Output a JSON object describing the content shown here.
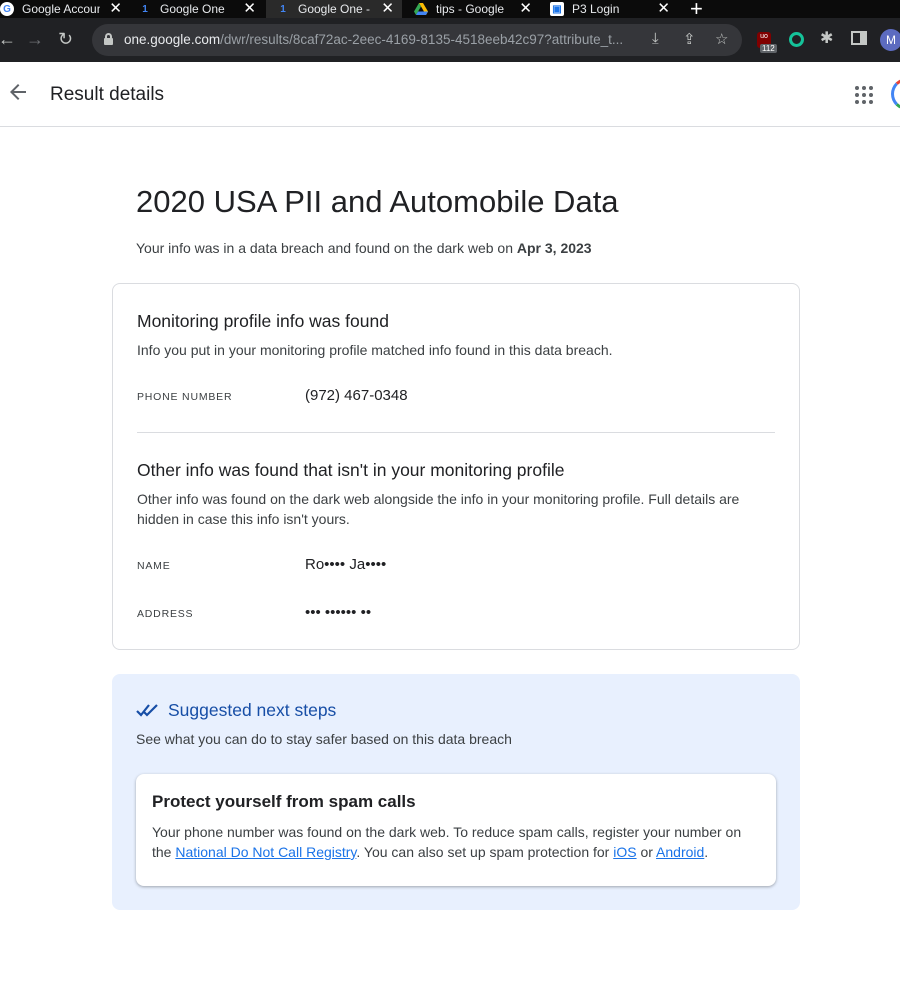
{
  "browser": {
    "tabs": [
      {
        "title": "Google Account",
        "active": false
      },
      {
        "title": "Google One",
        "active": false
      },
      {
        "title": "Google One -",
        "active": true
      },
      {
        "title": "tips - Google",
        "active": false
      },
      {
        "title": "P3 Login",
        "active": false
      }
    ],
    "url_domain": "one.google.com",
    "url_path": "/dwr/results/8caf72ac-2eec-4169-8135-4518eeb42c97?attribute_t...",
    "extension_badge": "112",
    "profile_initial": "M"
  },
  "header": {
    "title": "Result details"
  },
  "breach": {
    "title": "2020 USA PII and Automobile Data",
    "subtitle_prefix": "Your info was in a data breach and found on the dark web on ",
    "date": "Apr 3, 2023"
  },
  "monitoring": {
    "heading": "Monitoring profile info was found",
    "description": "Info you put in your monitoring profile matched info found in this data breach.",
    "phone_label": "PHONE NUMBER",
    "phone_value": "(972) 467-0348"
  },
  "other_info": {
    "heading": "Other info was found that isn't in your monitoring profile",
    "description": "Other info was found on the dark web alongside the info in your monitoring profile. Full details are hidden in case this info isn't yours.",
    "name_label": "NAME",
    "name_value": "Ro•••• Ja••••",
    "address_label": "ADDRESS",
    "address_value": "••• •••••• ••"
  },
  "next_steps": {
    "title": "Suggested next steps",
    "description": "See what you can do to stay safer based on this data breach",
    "card_title": "Protect yourself from spam calls",
    "card_text_1": "Your phone number was found on the dark web. To reduce spam calls, register your number on the ",
    "link_registry": "National Do Not Call Registry",
    "card_text_2": ". You can also set up spam protection for ",
    "link_ios": "iOS",
    "card_text_3": " or ",
    "link_android": "Android",
    "card_text_4": "."
  },
  "colors": {
    "accent": "#1a73e8",
    "steps_background": "#e8f0fe",
    "steps_title": "#174ea6"
  }
}
